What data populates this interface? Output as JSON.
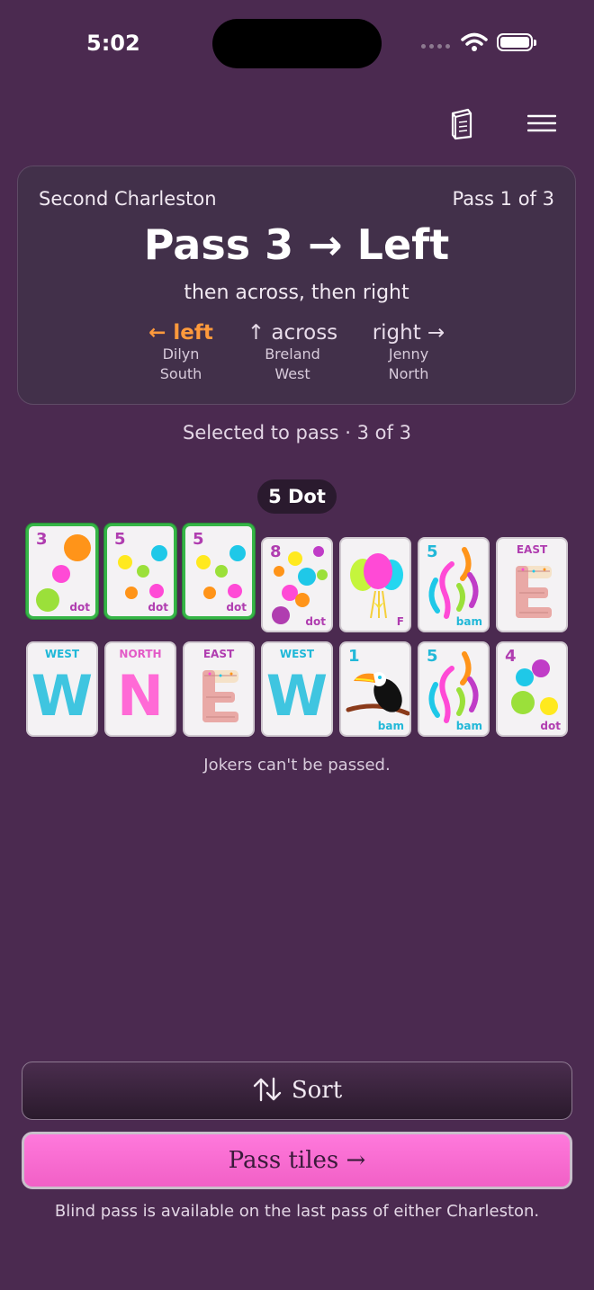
{
  "status": {
    "time": "5:02"
  },
  "charleston": {
    "stage": "Second Charleston",
    "pass_count": "Pass 1 of 3",
    "headline": "Pass 3 → Left",
    "subline": "then across, then right",
    "directions": [
      {
        "label": "← left",
        "name": "Dilyn",
        "seat": "South",
        "active": true
      },
      {
        "label": "↑ across",
        "name": "Breland",
        "seat": "West",
        "active": false
      },
      {
        "label": "right →",
        "name": "Jenny",
        "seat": "North",
        "active": false
      }
    ]
  },
  "selection": {
    "text": "Selected to pass · 3 of 3",
    "focused_tile": "5 Dot"
  },
  "tiles_row1": [
    {
      "number": "3",
      "suit": "dot",
      "selected": true
    },
    {
      "number": "5",
      "suit": "dot",
      "selected": true
    },
    {
      "number": "5",
      "suit": "dot",
      "selected": true
    },
    {
      "number": "8",
      "suit": "dot",
      "selected": false
    },
    {
      "number": "",
      "suit": "F",
      "selected": false
    },
    {
      "number": "5",
      "suit": "bam",
      "selected": false
    },
    {
      "wind": "EAST",
      "selected": false
    }
  ],
  "tiles_row2": [
    {
      "wind": "WEST",
      "letter": "W"
    },
    {
      "wind": "NORTH",
      "letter": "N"
    },
    {
      "wind": "EAST"
    },
    {
      "wind": "WEST",
      "letter": "W"
    },
    {
      "number": "1",
      "suit": "bam"
    },
    {
      "number": "5",
      "suit": "bam"
    },
    {
      "number": "4",
      "suit": "dot"
    }
  ],
  "note": "Jokers can't be passed.",
  "buttons": {
    "sort": "Sort",
    "pass": "Pass tiles →"
  },
  "footer": "Blind pass is available on the last pass of either Charleston.",
  "colors": {
    "background": "#4b2a50",
    "accent": "#ff9a3c",
    "pass_button": "#f56acb",
    "selected_border": "#35b546",
    "dot_suit": "#b03db0",
    "bam_suit": "#22b8d8"
  }
}
